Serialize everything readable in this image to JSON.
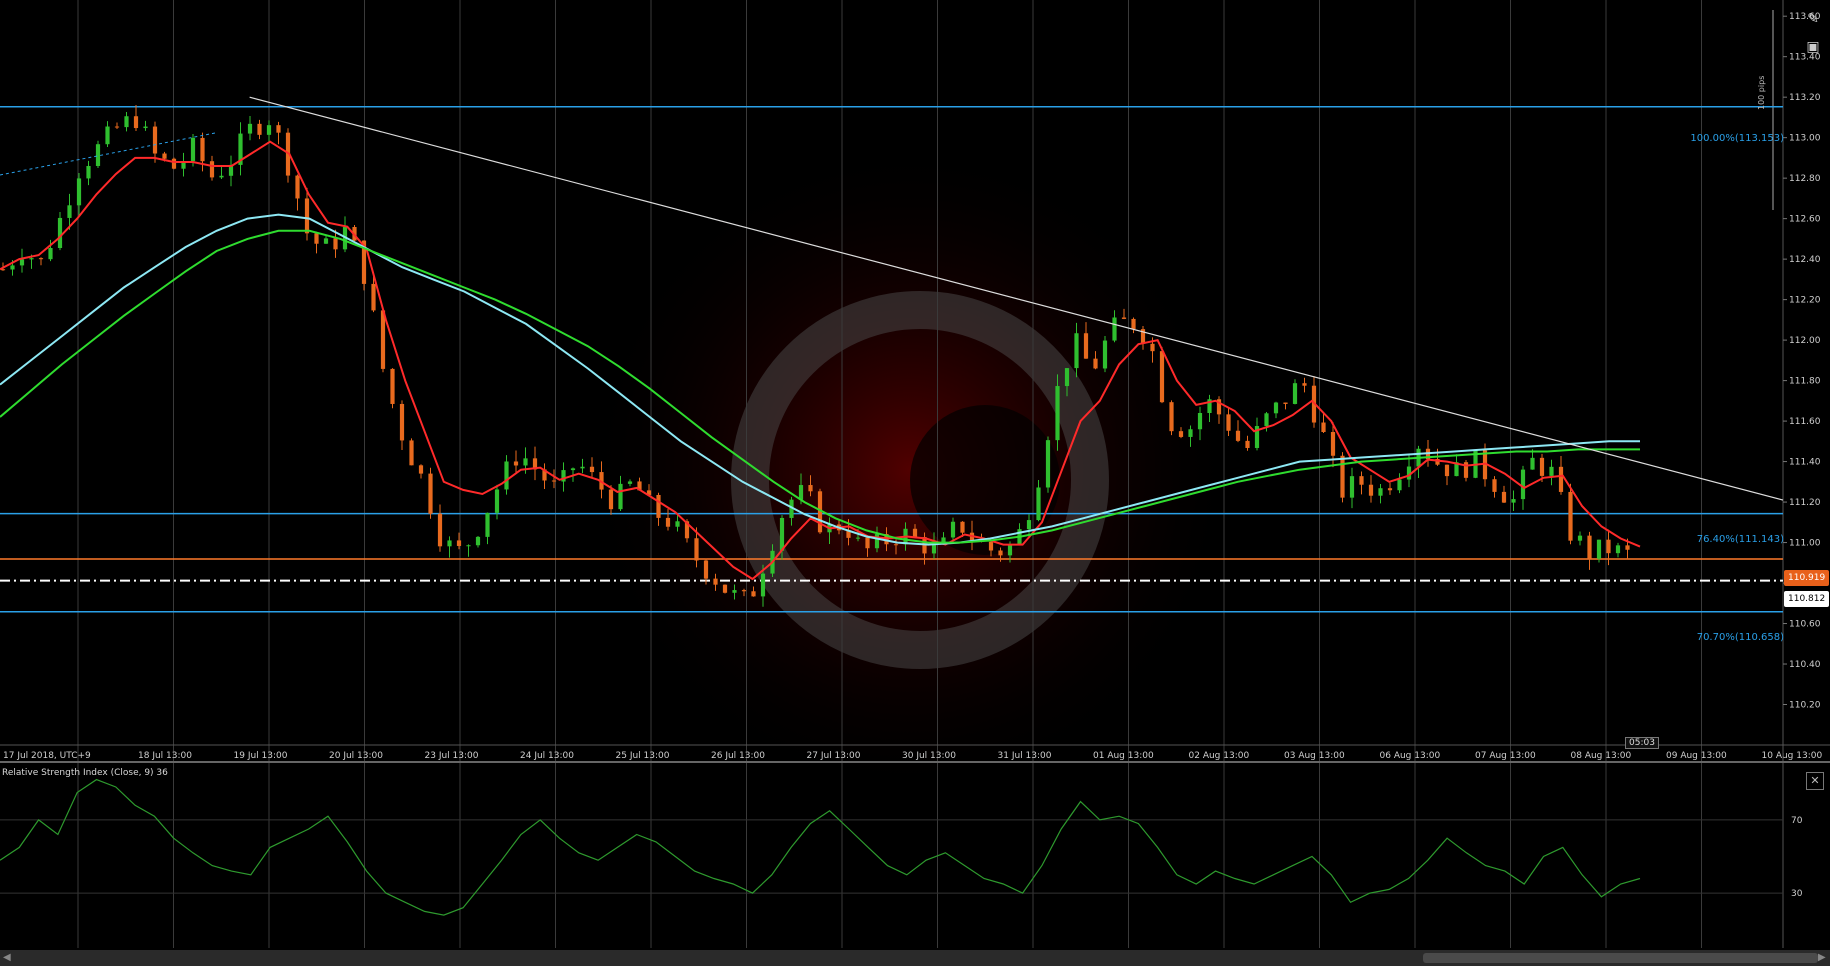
{
  "chart_data": [
    {
      "type": "candlestick",
      "symbol_timezone": "UTC+9",
      "x_tick_labels": [
        "17 Jul 2018, UTC+9",
        "18 Jul 13:00",
        "19 Jul 13:00",
        "20 Jul 13:00",
        "23 Jul 13:00",
        "24 Jul 13:00",
        "25 Jul 13:00",
        "26 Jul 13:00",
        "27 Jul 13:00",
        "30 Jul 13:00",
        "31 Jul 13:00",
        "01 Aug 13:00",
        "02 Aug 13:00",
        "03 Aug 13:00",
        "06 Aug 13:00",
        "07 Aug 13:00",
        "08 Aug 13:00",
        "09 Aug 13:00",
        "10 Aug 13:00"
      ],
      "y_tick_labels": [
        "110.20",
        "110.40",
        "110.60",
        "110.80",
        "111.00",
        "111.20",
        "111.40",
        "111.60",
        "111.80",
        "112.00",
        "112.20",
        "112.40",
        "112.60",
        "112.80",
        "113.00",
        "113.20",
        "113.40",
        "113.60"
      ],
      "ylim": [
        110.0,
        113.68
      ],
      "price_path": [
        112.35,
        112.45,
        112.38,
        112.6,
        112.85,
        112.95,
        113.05,
        113.1,
        112.9,
        112.85,
        112.95,
        112.8,
        112.9,
        113.05,
        113.1,
        112.85,
        112.5,
        112.45,
        112.55,
        112.3,
        111.8,
        111.5,
        111.3,
        111.0,
        110.95,
        111.1,
        111.3,
        111.45,
        111.35,
        111.25,
        111.4,
        111.3,
        111.2,
        111.3,
        111.15,
        111.1,
        110.95,
        110.85,
        110.75,
        110.7,
        110.95,
        111.2,
        111.25,
        111.05,
        111.1,
        110.95,
        111.0,
        111.05,
        111.0,
        110.95,
        111.1,
        111.0,
        110.95,
        111.0,
        111.25,
        111.7,
        112.0,
        111.85,
        112.05,
        112.1,
        112.0,
        111.6,
        111.55,
        111.7,
        111.6,
        111.45,
        111.6,
        111.7,
        111.8,
        111.55,
        111.25,
        111.3,
        111.25,
        111.35,
        111.5,
        111.4,
        111.35,
        111.4,
        111.3,
        111.2,
        111.4,
        111.35,
        111.05,
        110.95,
        110.97,
        110.94
      ],
      "candle_labels": [],
      "series": [
        {
          "name": "",
          "color": "#ff2a2a",
          "values": [
            112.35,
            112.4,
            112.42,
            112.5,
            112.6,
            112.72,
            112.82,
            112.9,
            112.9,
            112.88,
            112.88,
            112.86,
            112.86,
            112.92,
            112.98,
            112.92,
            112.72,
            112.58,
            112.56,
            112.45,
            112.1,
            111.8,
            111.55,
            111.3,
            111.26,
            111.24,
            111.29,
            111.36,
            111.37,
            111.31,
            111.34,
            111.31,
            111.25,
            111.27,
            111.21,
            111.15,
            111.06,
            110.97,
            110.88,
            110.82,
            110.9,
            111.02,
            111.12,
            111.07,
            111.08,
            111.03,
            111.02,
            111.03,
            111.02,
            110.99,
            111.04,
            111.02,
            110.99,
            110.99,
            111.1,
            111.35,
            111.6,
            111.7,
            111.88,
            111.98,
            112.0,
            111.8,
            111.68,
            111.7,
            111.65,
            111.55,
            111.58,
            111.63,
            111.7,
            111.6,
            111.42,
            111.36,
            111.3,
            111.33,
            111.41,
            111.4,
            111.38,
            111.39,
            111.34,
            111.27,
            111.32,
            111.33,
            111.18,
            111.08,
            111.02,
            110.98
          ]
        },
        {
          "name": "",
          "color": "#8de8f4",
          "values": [
            111.78,
            111.9,
            112.02,
            112.14,
            112.26,
            112.36,
            112.46,
            112.54,
            112.6,
            112.62,
            112.6,
            112.52,
            112.44,
            112.36,
            112.3,
            112.24,
            112.16,
            112.08,
            111.97,
            111.86,
            111.74,
            111.62,
            111.5,
            111.4,
            111.3,
            111.22,
            111.14,
            111.08,
            111.03,
            111.0,
            110.99,
            111.0,
            111.02,
            111.05,
            111.08,
            111.12,
            111.16,
            111.2,
            111.24,
            111.28,
            111.32,
            111.36,
            111.4,
            111.41,
            111.42,
            111.43,
            111.44,
            111.45,
            111.46,
            111.47,
            111.48,
            111.49,
            111.5,
            111.5
          ]
        },
        {
          "name": "",
          "color": "#2fdc2f",
          "values": [
            111.62,
            111.75,
            111.88,
            112.0,
            112.12,
            112.23,
            112.34,
            112.44,
            112.5,
            112.54,
            112.54,
            112.5,
            112.44,
            112.38,
            112.32,
            112.26,
            112.2,
            112.13,
            112.05,
            111.97,
            111.87,
            111.76,
            111.64,
            111.52,
            111.41,
            111.3,
            111.2,
            111.12,
            111.06,
            111.02,
            111.0,
            111.0,
            111.01,
            111.03,
            111.06,
            111.1,
            111.14,
            111.18,
            111.22,
            111.26,
            111.3,
            111.33,
            111.36,
            111.38,
            111.4,
            111.41,
            111.42,
            111.43,
            111.44,
            111.45,
            111.45,
            111.46,
            111.46,
            111.46
          ]
        }
      ],
      "horizontal_levels": [
        {
          "value": 113.153,
          "label": "100.00%(113.153)",
          "color": "#2aa0e8"
        },
        {
          "value": 111.143,
          "label": "76.40%(111.143)",
          "color": "#2aa0e8"
        },
        {
          "value": 110.658,
          "label": "70.70%(110.658)",
          "color": "#2aa0e8"
        },
        {
          "value": 110.919,
          "label": "",
          "color": "#ff7a2a"
        },
        {
          "value": 110.812,
          "label": "",
          "color": "#ffffff"
        }
      ],
      "trendline": {
        "from": [
          0.14,
          113.2
        ],
        "to": [
          1.0,
          111.21
        ],
        "color": "#dddddd"
      },
      "grid": true
    },
    {
      "type": "line",
      "title": "Relative Strength Index (Close, 9) 36",
      "y_tick_labels": [
        "70",
        "30"
      ],
      "ylim": [
        0,
        100
      ],
      "series": [
        {
          "name": "",
          "color": "#2e9a2e",
          "values": [
            48,
            55,
            70,
            62,
            85,
            92,
            88,
            78,
            72,
            60,
            52,
            45,
            42,
            40,
            55,
            60,
            65,
            72,
            58,
            42,
            30,
            25,
            20,
            18,
            22,
            35,
            48,
            62,
            70,
            60,
            52,
            48,
            55,
            62,
            58,
            50,
            42,
            38,
            35,
            30,
            40,
            55,
            68,
            75,
            65,
            55,
            45,
            40,
            48,
            52,
            45,
            38,
            35,
            30,
            45,
            65,
            80,
            70,
            72,
            68,
            55,
            40,
            35,
            42,
            38,
            35,
            40,
            45,
            50,
            40,
            25,
            30,
            32,
            38,
            48,
            60,
            52,
            45,
            42,
            35,
            50,
            55,
            40,
            28,
            35,
            38
          ]
        }
      ],
      "current_value": "36"
    }
  ],
  "price_axis": {
    "current_price": "110.919",
    "line_price": "110.812"
  },
  "header": {
    "pips_label": "100 pips"
  },
  "fib_labels": {
    "l100": "100.00%(113.153)",
    "l764": "76.40%(111.143)",
    "l707": "70.70%(110.658)"
  },
  "rsi": {
    "title": "Relative Strength Index (Close, 9) 36"
  },
  "timer": {
    "label": "05:03"
  },
  "icons": {
    "edit": "edit-icon",
    "camera": "camera-icon",
    "close": "close-icon"
  },
  "colors": {
    "background": "#000000",
    "grid": "#3a3a3a",
    "bull": "#2fbf2f",
    "bear": "#e86a1e",
    "axis_text": "#cfcfcf"
  }
}
